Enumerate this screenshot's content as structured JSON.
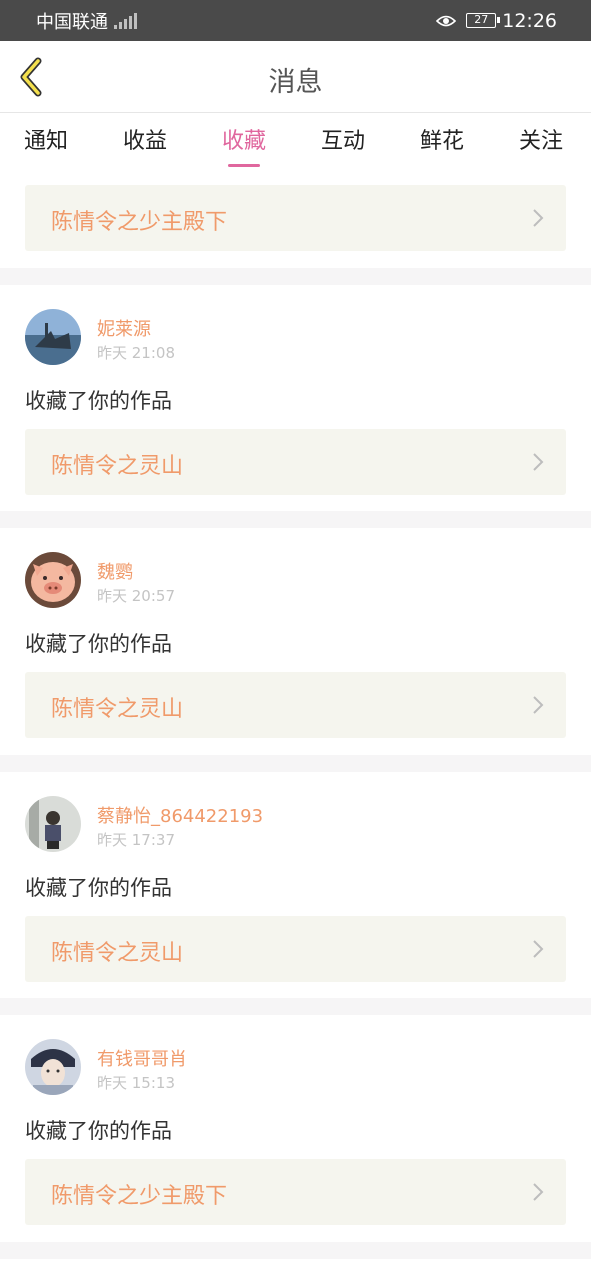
{
  "status_bar": {
    "carrier": "中国联通",
    "battery": "27",
    "time": "12:26"
  },
  "header": {
    "title": "消息",
    "back_icon": "chevron-left-icon"
  },
  "tabs": [
    {
      "label": "通知",
      "active": false
    },
    {
      "label": "收益",
      "active": false
    },
    {
      "label": "收藏",
      "active": true
    },
    {
      "label": "互动",
      "active": false
    },
    {
      "label": "鲜花",
      "active": false
    },
    {
      "label": "关注",
      "active": false
    }
  ],
  "colors": {
    "accent": "#e0679e",
    "work_title": "#f09a6a",
    "work_bar_bg": "#f5f5ee"
  },
  "top_item": {
    "work_title": "陈情令之少主殿下"
  },
  "items": [
    {
      "username": "妮莱源",
      "time": "昨天 21:08",
      "action": "收藏了你的作品",
      "work_title": "陈情令之灵山"
    },
    {
      "username": "魏鹦",
      "time": "昨天 20:57",
      "action": "收藏了你的作品",
      "work_title": "陈情令之灵山"
    },
    {
      "username": "蔡静怡_864422193",
      "time": "昨天 17:37",
      "action": "收藏了你的作品",
      "work_title": "陈情令之灵山"
    },
    {
      "username": "有钱哥哥肖",
      "time": "昨天 15:13",
      "action": "收藏了你的作品",
      "work_title": "陈情令之少主殿下"
    }
  ]
}
